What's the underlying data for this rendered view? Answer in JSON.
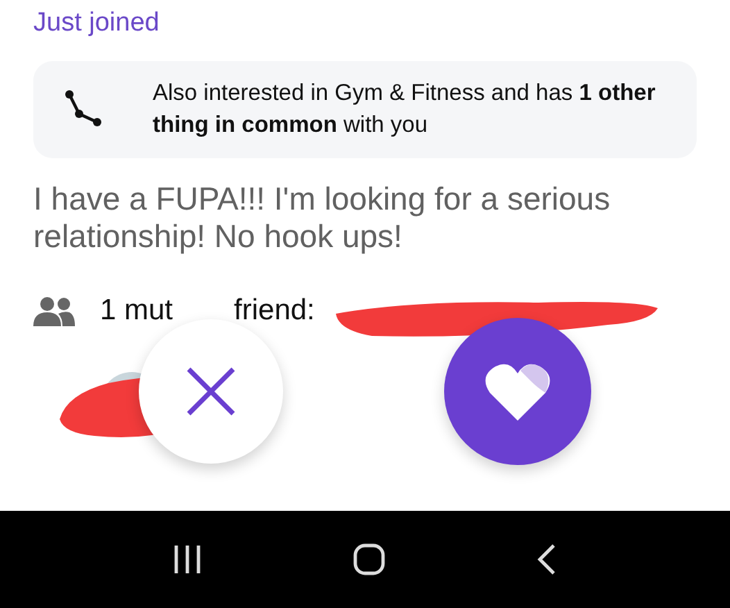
{
  "header": {
    "label": "Just joined"
  },
  "common_card": {
    "text": "Also interested in Gym & Fitness and has **1 other thing in common** with you"
  },
  "bio": "I have a FUPA!!! I'm looking for a serious relationship! No hook ups!",
  "mutual_friends": {
    "parts": [
      "1 mut",
      "friend:"
    ]
  },
  "actions": [
    {
      "kind": "dislike"
    },
    {
      "kind": "like"
    }
  ],
  "nav_bar": [
    {
      "kind": "recents"
    },
    {
      "kind": "home"
    },
    {
      "kind": "back"
    }
  ]
}
